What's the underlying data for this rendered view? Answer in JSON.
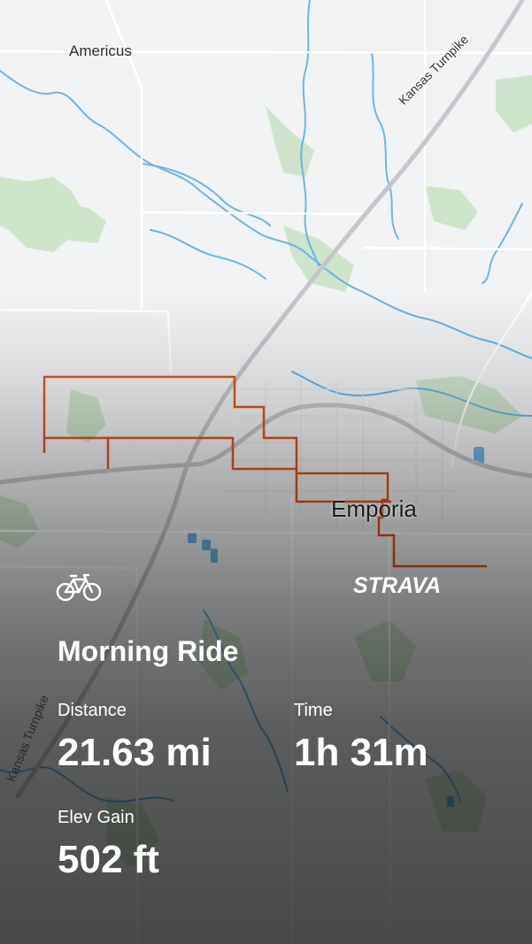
{
  "map": {
    "place_labels": {
      "americus": "Americus",
      "emporia": "Emporia",
      "turnpike_north": "Kansas Turnpike",
      "turnpike_south": "Kansas Turnpike"
    },
    "colors": {
      "background": "#f1f2f4",
      "road": "#ffffff",
      "water": "#6bb6e6",
      "park": "#c9e2c5",
      "route": "#e0541c"
    }
  },
  "activity": {
    "icon": "bicycle-icon",
    "brand": "STRAVA",
    "title": "Morning Ride",
    "stats": {
      "distance_label": "Distance",
      "distance_value": "21.63 mi",
      "time_label": "Time",
      "time_value": "1h 31m",
      "elev_label": "Elev Gain",
      "elev_value": "502 ft"
    }
  }
}
